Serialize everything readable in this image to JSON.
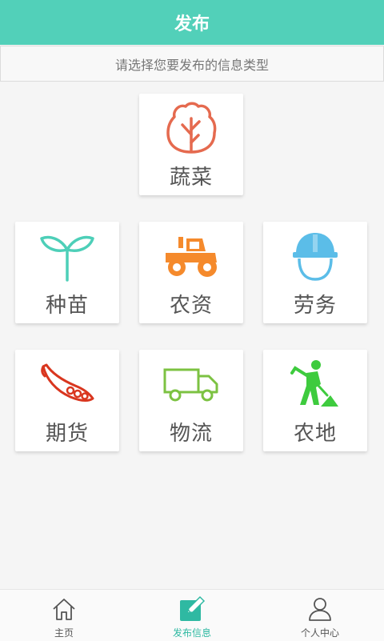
{
  "header": {
    "title": "发布"
  },
  "prompt": "请选择您要发布的信息类型",
  "categories": {
    "vegetable": {
      "label": "蔬菜",
      "icon": "lettuce-icon",
      "color": "#e56a4f"
    },
    "seedling": {
      "label": "种苗",
      "icon": "seedling-icon",
      "color": "#4dcfb8"
    },
    "agri_supply": {
      "label": "农资",
      "icon": "tractor-icon",
      "color": "#f58a2c"
    },
    "labor": {
      "label": "劳务",
      "icon": "hard-hat-icon",
      "color": "#5bbde8"
    },
    "futures": {
      "label": "期货",
      "icon": "pea-pod-icon",
      "color": "#d9361f"
    },
    "logistics": {
      "label": "物流",
      "icon": "truck-icon",
      "color": "#7cc242"
    },
    "farmland": {
      "label": "农地",
      "icon": "digging-worker-icon",
      "color": "#3ecb3e"
    }
  },
  "bottom_nav": {
    "home": {
      "label": "主页",
      "icon": "home-icon"
    },
    "publish": {
      "label": "发布信息",
      "icon": "edit-icon",
      "active": true,
      "color": "#2fb9a2"
    },
    "profile": {
      "label": "个人中心",
      "icon": "user-icon"
    }
  }
}
